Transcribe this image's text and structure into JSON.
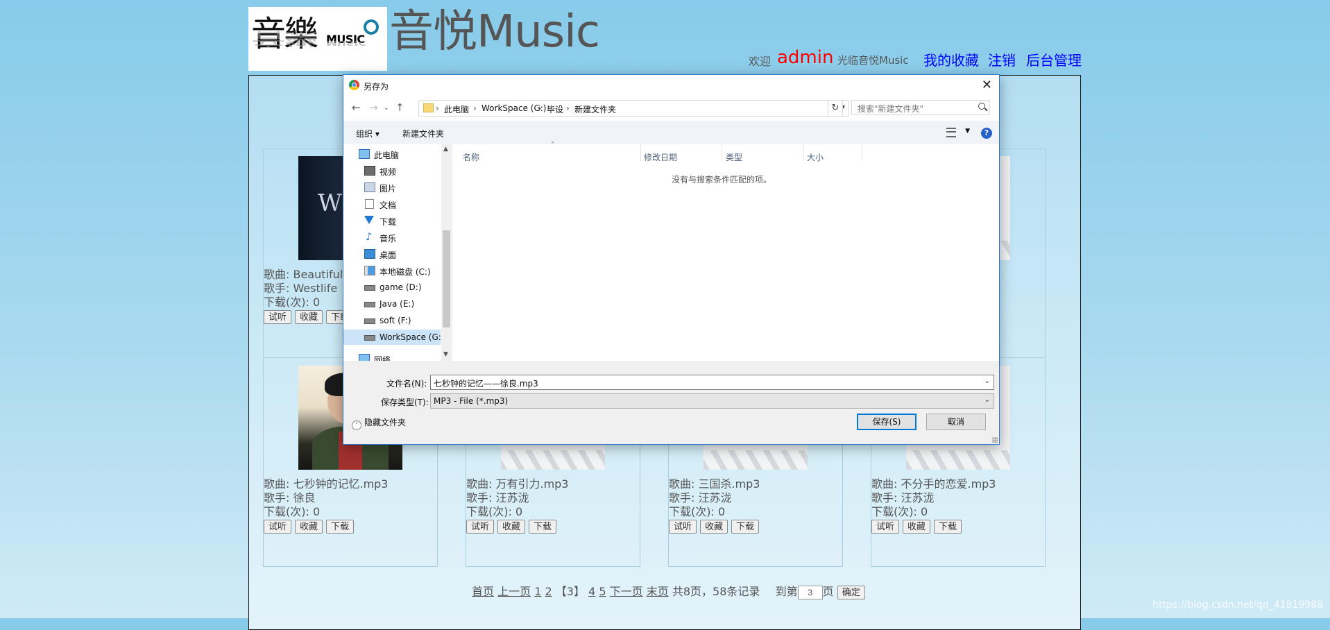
{
  "site": {
    "logo_cjk": "音樂",
    "logo_music": "MUSIC",
    "title": "音悦Music",
    "nav": {
      "welcome": "欢迎",
      "user": "admin",
      "visit": "光临音悦Music",
      "favorites": "我的收藏",
      "logout": "注销",
      "admin": "后台管理"
    },
    "colors": {
      "user": "#ff0000",
      "link": "#0000ff",
      "text": "#555555"
    }
  },
  "songs": [
    {
      "name": "歌曲: Beautiful",
      "singer": "歌手: Westlife",
      "downloads": "下载(次): 0",
      "art": "westlife"
    },
    {
      "name": "歌曲: 七秒钟的记忆.mp3",
      "singer": "歌手: 徐良",
      "downloads": "下载(次): 0",
      "art": "xuliang"
    },
    {
      "name": "歌曲: 万有引力.mp3",
      "singer": "歌手: 汪苏泷",
      "downloads": "下载(次): 0",
      "art": "default"
    },
    {
      "name": "歌曲: 三国杀.mp3",
      "singer": "歌手: 汪苏泷",
      "downloads": "下载(次): 0",
      "art": "default"
    },
    {
      "name": "歌曲: 不分手的恋爱.mp3",
      "singer": "歌手: 汪苏泷",
      "downloads": "下载(次): 0",
      "art": "default"
    }
  ],
  "card_buttons": {
    "listen": "试听",
    "favorite": "收藏",
    "download": "下载"
  },
  "pagination": {
    "first": "首页",
    "prev": "上一页",
    "pages_before": [
      "1",
      "2"
    ],
    "current": "【3】",
    "pages_after": [
      "4",
      "5"
    ],
    "next": "下一页",
    "last": "末页",
    "summary": "共8页，58条记录",
    "goto_prefix": "到第",
    "goto_value": "3",
    "goto_suffix": "页",
    "confirm": "确定"
  },
  "dialog": {
    "title": "另存为",
    "breadcrumb": [
      "此电脑",
      "WorkSpace (G:)",
      "毕设",
      "新建文件夹"
    ],
    "search_placeholder": "搜索\"新建文件夹\"",
    "toolbar": {
      "organize": "组织 ▾",
      "new_folder": "新建文件夹"
    },
    "tree": [
      {
        "label": "此电脑",
        "icon": "pc-icon",
        "indent": 1
      },
      {
        "label": "视频",
        "icon": "video-icon",
        "indent": 2
      },
      {
        "label": "图片",
        "icon": "picture-icon",
        "indent": 2
      },
      {
        "label": "文档",
        "icon": "document-icon",
        "indent": 2
      },
      {
        "label": "下载",
        "icon": "download-icon",
        "indent": 2
      },
      {
        "label": "音乐",
        "icon": "music-icon",
        "indent": 2
      },
      {
        "label": "桌面",
        "icon": "desktop-icon",
        "indent": 2
      },
      {
        "label": "本地磁盘 (C:)",
        "icon": "windows-drive-icon",
        "indent": 2
      },
      {
        "label": "game (D:)",
        "icon": "drive-icon",
        "indent": 2
      },
      {
        "label": "Java (E:)",
        "icon": "drive-icon",
        "indent": 2
      },
      {
        "label": "soft (F:)",
        "icon": "drive-icon",
        "indent": 2
      },
      {
        "label": "WorkSpace (G:",
        "icon": "drive-icon",
        "indent": 2,
        "selected": true
      },
      {
        "label": "网络",
        "icon": "network-icon",
        "indent": 1
      }
    ],
    "columns": [
      "名称",
      "修改日期",
      "类型",
      "大小"
    ],
    "empty_message": "没有与搜索条件匹配的项。",
    "filename_label": "文件名(N):",
    "filename_value": "七秒钟的记忆——徐良.mp3",
    "filetype_label": "保存类型(T):",
    "filetype_value": "MP3 - File (*.mp3)",
    "hide_folders": "隐藏文件夹",
    "save": "保存(S)",
    "cancel": "取消"
  },
  "watermark": "https://blog.csdn.net/qq_41819988"
}
